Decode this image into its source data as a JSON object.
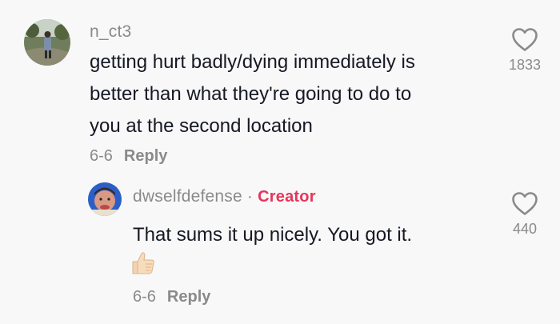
{
  "comments": [
    {
      "username": "n_ct3",
      "text_lines": [
        "getting hurt badly/dying immediately is",
        "better than what they're going to do to",
        "you at the second location"
      ],
      "date": "6-6",
      "reply_label": "Reply",
      "likes": "1833"
    }
  ],
  "reply": {
    "username": "dwselfdefense",
    "separator": "·",
    "badge": "Creator",
    "text": "That sums it up nicely. You got it.",
    "emoji": "👍",
    "date": "6-6",
    "reply_label": "Reply",
    "likes": "440"
  },
  "icons": {
    "like": "heart-outline-icon",
    "emoji": "thumbs-up-emoji"
  },
  "colors": {
    "background": "#f8f8f8",
    "text": "#161823",
    "muted": "#8a8a8a",
    "creator_badge": "#e8345a"
  }
}
